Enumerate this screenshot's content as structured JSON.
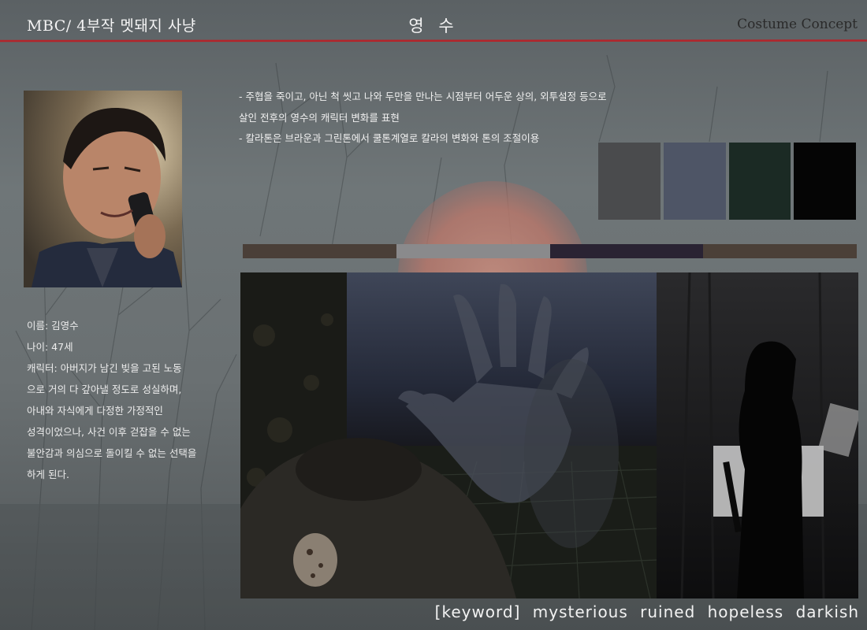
{
  "header": {
    "left_title": "MBC/ 4부작 멧돼지 사냥",
    "center_title": "영 수",
    "right_title": "Costume Concept"
  },
  "profile": {
    "lines": [
      "이름: 김영수",
      "나이: 47세",
      "캐릭터: 아버지가 남긴 빚을 고된 노동",
      "으로 거의 다 갚아낼 정도로 성실하며,",
      "아내와 자식에게 다정한 가정적인",
      "성격이었으나, 사건 이후 걷잡을 수 없는",
      "불안감과 의심으로 돌이킬 수 없는 선택을",
      "하게 된다."
    ]
  },
  "concept_notes": [
    "- 주협을 죽이고, 아닌 척 씻고 나와 두만을 만나는 시점부터 어두운 상의, 외투설정 등으로",
    "살인 전후의 영수의 캐릭터 변화를 표현",
    "- 칼라톤은 브라운과 그린톤에서 쿨톤계열로 칼라의 변화와 톤의 조절이용"
  ],
  "palette": {
    "swatches": [
      "#4a4b4d",
      "#4e5566",
      "#1b2a24",
      "#050505"
    ],
    "stripe": [
      "#4a3f38",
      "#8a8a8c",
      "#2a2333",
      "#4b4038"
    ]
  },
  "keywords_line": "[keyword]  mysterious  ruined  hopeless  darkish"
}
